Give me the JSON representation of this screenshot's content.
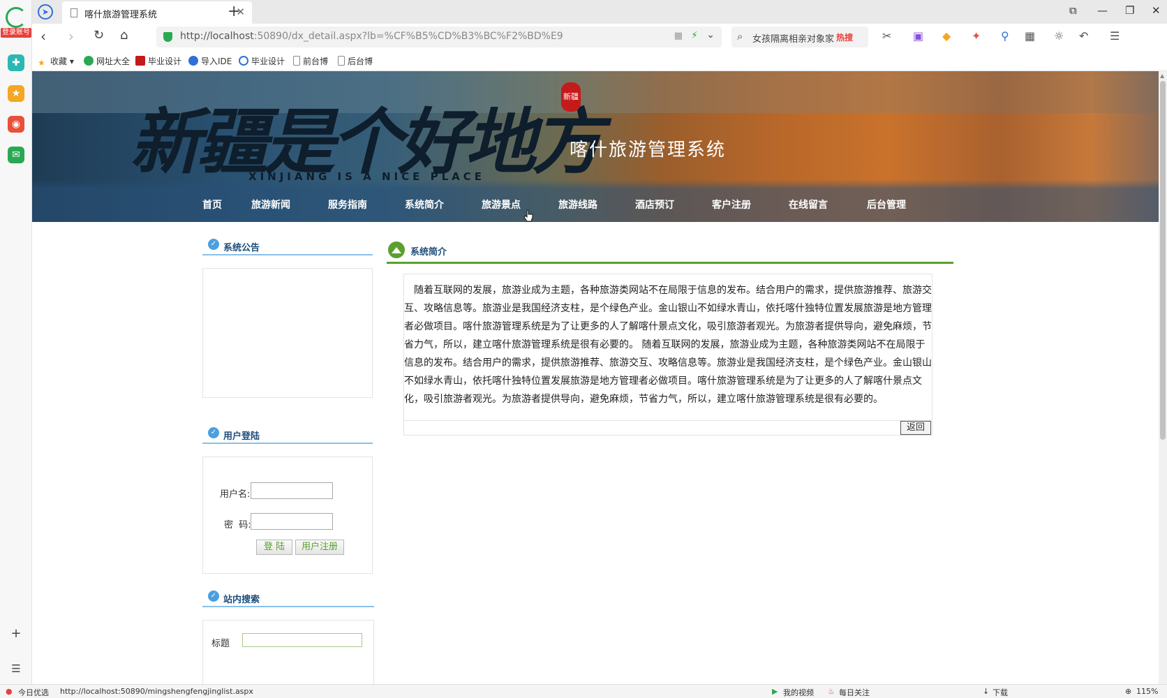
{
  "browser": {
    "login_badge": "登录账号",
    "tab_title": "喀什旅游管理系统",
    "url_host": "http://localhost",
    "url_rest": ":50890/dx_detail.aspx?lb=%CF%B5%CD%B3%BC%F2%BD%E9",
    "search_text": "女孩隔离相亲对象家",
    "search_hot": "热搜",
    "bookmarks": [
      "收藏",
      "网址大全",
      "毕业设计",
      "导入IDE",
      "毕业设计",
      "前台博",
      "后台博"
    ],
    "status_url": "http://localhost:50890/mingshengfengjinglist.aspx",
    "status_left": "今日优选",
    "status_video": "我的视频",
    "status_follow": "每日关注",
    "status_download": "下载",
    "zoom": "115%"
  },
  "banner": {
    "slogan": "新疆是个好地方",
    "english": "XINJIANG IS A NICE PLACE",
    "system_name": "喀什旅游管理系统",
    "seal": "新疆"
  },
  "menu": [
    "首页",
    "旅游新闻",
    "服务指南",
    "系统简介",
    "旅游景点",
    "旅游线路",
    "酒店预订",
    "客户注册",
    "在线留言",
    "后台管理"
  ],
  "sidebar": {
    "notice_title": "系统公告",
    "login_title": "用户登陆",
    "username_label": "用户名:",
    "password_label": "密  码:",
    "login_button": "登 陆",
    "register_button": "用户注册",
    "search_title": "站内搜索",
    "search_title_label": "标题"
  },
  "main": {
    "title": "系统简介",
    "content": "随着互联网的发展，旅游业成为主题，各种旅游类网站不在局限于信息的发布。结合用户的需求，提供旅游推荐、旅游交互、攻略信息等。旅游业是我国经济支柱，是个绿色产业。金山银山不如绿水青山，依托喀什独特位置发展旅游是地方管理者必做项目。喀什旅游管理系统是为了让更多的人了解喀什景点文化，吸引旅游者观光。为旅游者提供导向，避免麻烦，节省力气，所以，建立喀什旅游管理系统是很有必要的。    随着互联网的发展，旅游业成为主题，各种旅游类网站不在局限于信息的发布。结合用户的需求，提供旅游推荐、旅游交互、攻略信息等。旅游业是我国经济支柱，是个绿色产业。金山银山不如绿水青山，依托喀什独特位置发展旅游是地方管理者必做项目。喀什旅游管理系统是为了让更多的人了解喀什景点文化，吸引旅游者观光。为旅游者提供导向，避免麻烦，节省力气，所以，建立喀什旅游管理系统是很有必要的。",
    "back_button": "返回"
  }
}
